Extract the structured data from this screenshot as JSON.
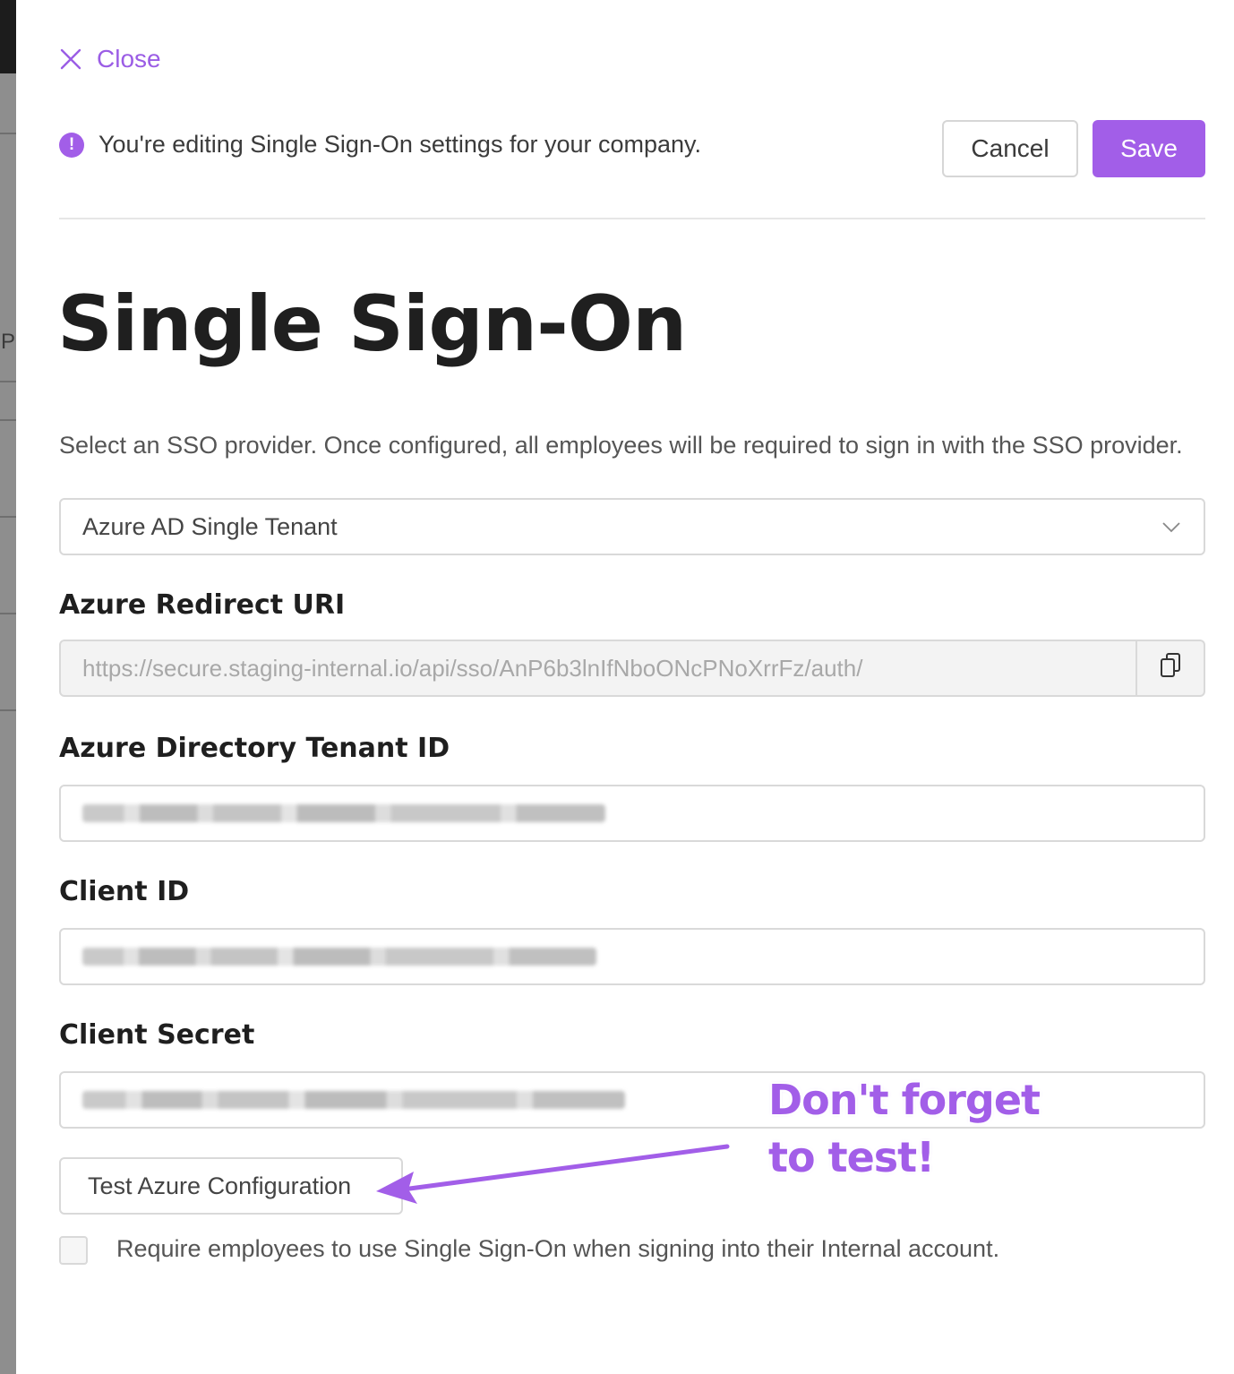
{
  "backdrop": {
    "partial_letter": "P"
  },
  "header": {
    "close_label": "Close",
    "notice_text": "You're editing Single Sign-On settings for your company.",
    "notice_icon": "!",
    "cancel_label": "Cancel",
    "save_label": "Save"
  },
  "page": {
    "title": "Single Sign-On",
    "description": "Select an SSO provider. Once configured, all employees will be required to sign in with the SSO provider."
  },
  "provider_select": {
    "value": "Azure AD Single Tenant"
  },
  "fields": {
    "redirect_uri": {
      "label": "Azure Redirect URI",
      "value": "https://secure.staging-internal.io/api/sso/AnP6b3lnIfNboONcPNoXrrFz/auth/"
    },
    "tenant_id": {
      "label": "Azure Directory Tenant ID"
    },
    "client_id": {
      "label": "Client ID"
    },
    "client_secret": {
      "label": "Client Secret"
    }
  },
  "test_button_label": "Test Azure Configuration",
  "require_sso": {
    "checked": false,
    "label": "Require employees to use Single Sign-On when signing into their Internal account."
  },
  "annotation": {
    "line1": "Don't forget",
    "line2": "to test!"
  },
  "colors": {
    "accent": "#a25ee8",
    "border": "#d9d9d9",
    "readonly_bg": "#f3f3f3"
  }
}
